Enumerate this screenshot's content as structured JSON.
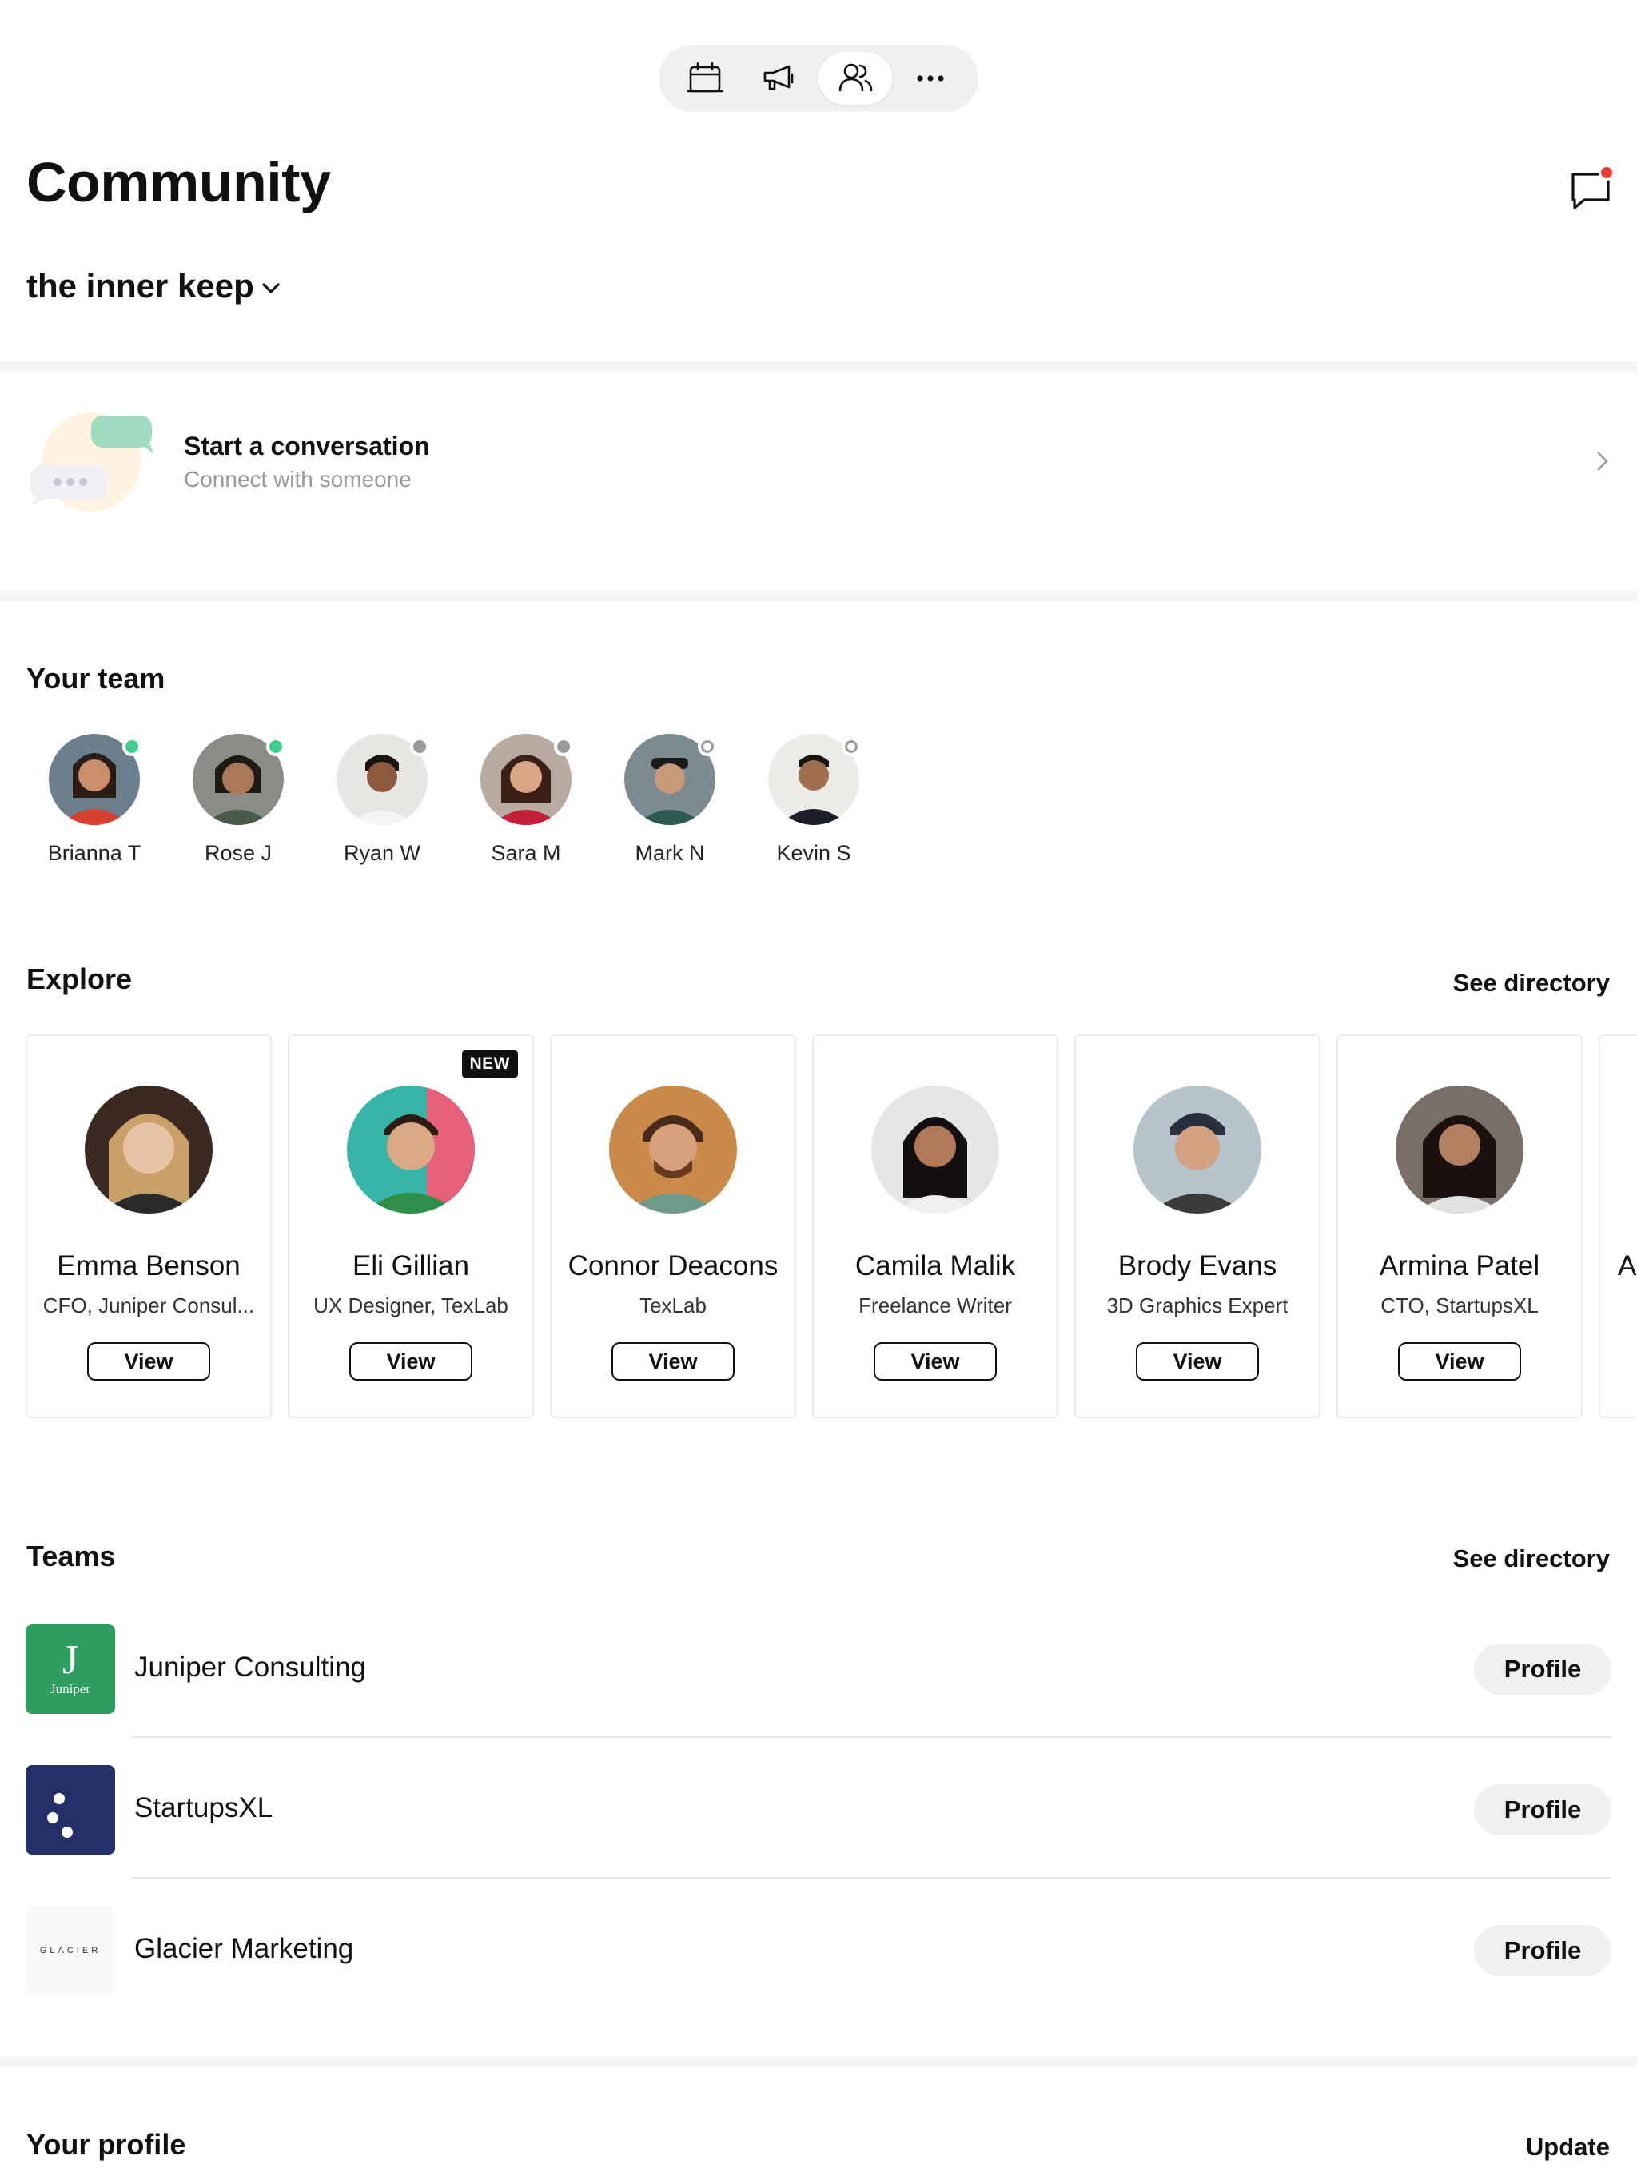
{
  "page": {
    "title": "Community"
  },
  "nav": {
    "tabs": [
      {
        "icon": "calendar-icon",
        "active": false
      },
      {
        "icon": "megaphone-icon",
        "active": false
      },
      {
        "icon": "people-icon",
        "active": true
      },
      {
        "icon": "more-icon",
        "active": false
      }
    ]
  },
  "community": {
    "name": "the inner keep"
  },
  "conversation": {
    "title": "Start a conversation",
    "subtitle": "Connect with someone"
  },
  "your_team": {
    "title": "Your team",
    "members": [
      {
        "name": "Brianna T",
        "status": "online"
      },
      {
        "name": "Rose J",
        "status": "online"
      },
      {
        "name": "Ryan W",
        "status": "away"
      },
      {
        "name": "Sara M",
        "status": "away"
      },
      {
        "name": "Mark N",
        "status": "offline"
      },
      {
        "name": "Kevin S",
        "status": "offline"
      }
    ]
  },
  "explore": {
    "title": "Explore",
    "link": "See directory",
    "cards": [
      {
        "name": "Emma Benson",
        "role": "CFO, Juniper Consul...",
        "button": "View",
        "badge": ""
      },
      {
        "name": "Eli Gillian",
        "role": "UX Designer, TexLab",
        "button": "View",
        "badge": "NEW"
      },
      {
        "name": "Connor Deacons",
        "role": "TexLab",
        "button": "View",
        "badge": ""
      },
      {
        "name": "Camila Malik",
        "role": "Freelance Writer",
        "button": "View",
        "badge": ""
      },
      {
        "name": "Brody Evans",
        "role": "3D Graphics Expert",
        "button": "View",
        "badge": ""
      },
      {
        "name": "Armina Patel",
        "role": "CTO, StartupsXL",
        "button": "View",
        "badge": ""
      }
    ],
    "peek_letter": "A"
  },
  "teams": {
    "title": "Teams",
    "link": "See directory",
    "items": [
      {
        "name": "Juniper Consulting",
        "button": "Profile",
        "logo_letter": "J",
        "logo_text": "Juniper"
      },
      {
        "name": "StartupsXL",
        "button": "Profile"
      },
      {
        "name": "Glacier Marketing",
        "button": "Profile",
        "logo_text": "GLACIER"
      }
    ]
  },
  "profile": {
    "title": "Your profile",
    "link": "Update"
  },
  "colors": {
    "online": "#3ecf8e",
    "away": "#9a9a9a",
    "notification": "#ec3b2e",
    "juniper": "#2e9e5f",
    "startups": "#25306b"
  }
}
